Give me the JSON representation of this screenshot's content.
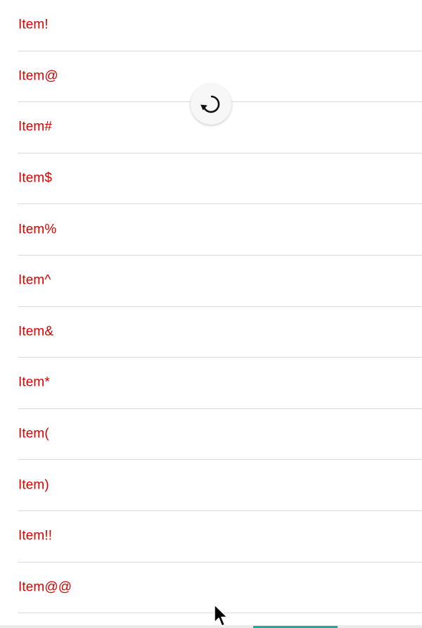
{
  "list": {
    "items": [
      {
        "label": "Item!"
      },
      {
        "label": "Item@"
      },
      {
        "label": "Item#"
      },
      {
        "label": "Item$"
      },
      {
        "label": "Item%"
      },
      {
        "label": "Item^"
      },
      {
        "label": "Item&"
      },
      {
        "label": "Item*"
      },
      {
        "label": "Item("
      },
      {
        "label": "Item)"
      },
      {
        "label": "Item!!"
      },
      {
        "label": "Item@@"
      }
    ]
  },
  "refresh": {
    "icon": "refresh-icon",
    "state": "spinning"
  },
  "colors": {
    "item_text": "#d50000",
    "divider": "#d9d9d9",
    "background": "#ffffff",
    "accent": "#26a69a"
  }
}
